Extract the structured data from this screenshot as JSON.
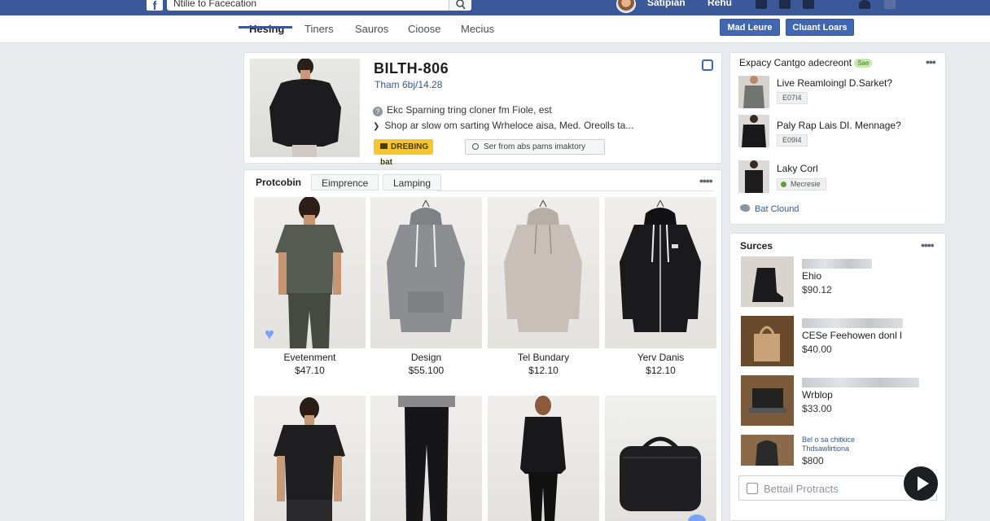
{
  "topbar": {
    "search_value": "Ntilie to Facecation",
    "user_name": "Satipian",
    "link": "Rehu"
  },
  "subnav": {
    "tabs": [
      "Hesing",
      "Tiners",
      "Sauros",
      "Cioose",
      "Mecius"
    ],
    "buttons": [
      "Mad Leure",
      "Cluant Loars"
    ]
  },
  "product": {
    "title": "BILTH-806",
    "subtitle": "Tham 6bj/14.28",
    "line1": "Ekc Sparning tring cloner fm Fiole, est",
    "line2": "Shop ar slow om sarting Wrheloce aisa, Med. Oreolls ta...",
    "btn_primary": "DREBING bat",
    "btn_secondary": "Ser from abs pams imaktory"
  },
  "grid": {
    "tabs": [
      "Protcobin",
      "Eimprence",
      "Lamping"
    ],
    "more": "••••",
    "items": [
      {
        "name": "Evetenment",
        "price": "$47.10"
      },
      {
        "name": "Design",
        "price": "$55.100"
      },
      {
        "name": "Tel Bundary",
        "price": "$12.10"
      },
      {
        "name": "Yerv Danis",
        "price": "$12.10"
      },
      {
        "name": "",
        "price": ""
      },
      {
        "name": "",
        "price": ""
      },
      {
        "name": "",
        "price": ""
      },
      {
        "name": "",
        "price": ""
      }
    ]
  },
  "side1": {
    "title": "Expacy Cantgo adecreont",
    "badge": "Sae",
    "more": "•••",
    "items": [
      {
        "name": "Live Reamloingl D.Sarket?",
        "tag": "E07I4"
      },
      {
        "name": "Paly Rap Lais DI. Mennage?",
        "tag": "E09I4"
      },
      {
        "name": "Laky Corl",
        "tag": "Mecresie"
      }
    ],
    "footer": "Bat Clound"
  },
  "side2": {
    "title": "Surces",
    "more": "••••",
    "items": [
      {
        "name": "Ehio",
        "price": "$90.12"
      },
      {
        "name": "CESe Feehowen donl l",
        "price": "$40.00"
      },
      {
        "name": "Wrblop",
        "price": "$33.00"
      },
      {
        "name": "Bel o sa chitkice\nThdsawlirtiona",
        "price": "$800"
      }
    ],
    "input_placeholder": "Bettail Protracts"
  },
  "colors": {
    "brand": "#3b5998",
    "accent_button": "#4267b2",
    "yellow": "#f7c52c"
  }
}
